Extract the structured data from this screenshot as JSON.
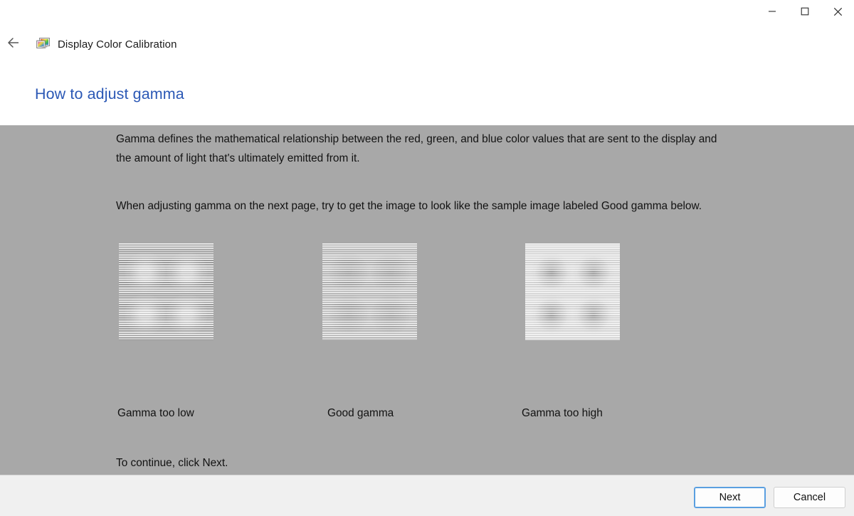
{
  "window": {
    "app_title": "Display Color Calibration",
    "app_icon": "display-color-icon",
    "back_icon": "back-arrow-icon",
    "controls": {
      "minimize": "minimize-icon",
      "maximize": "maximize-icon",
      "close": "close-icon"
    }
  },
  "page": {
    "heading": "How to adjust gamma",
    "paragraph1": "Gamma defines the mathematical relationship between the red, green, and blue color values that are sent to the display and the amount of light that's ultimately emitted from it.",
    "paragraph2": "When adjusting gamma on the next page, try to get the image to look like the sample image labeled Good gamma below.",
    "continue_text": "To continue, click Next."
  },
  "samples": [
    {
      "caption": "Gamma too low"
    },
    {
      "caption": "Good gamma"
    },
    {
      "caption": "Gamma too high"
    }
  ],
  "footer": {
    "next_label": "Next",
    "cancel_label": "Cancel"
  },
  "colors": {
    "heading": "#2b58b5",
    "content_bg": "#a8a8a8",
    "footer_bg": "#f0f0f0",
    "default_button_border": "#5a9fe0"
  }
}
